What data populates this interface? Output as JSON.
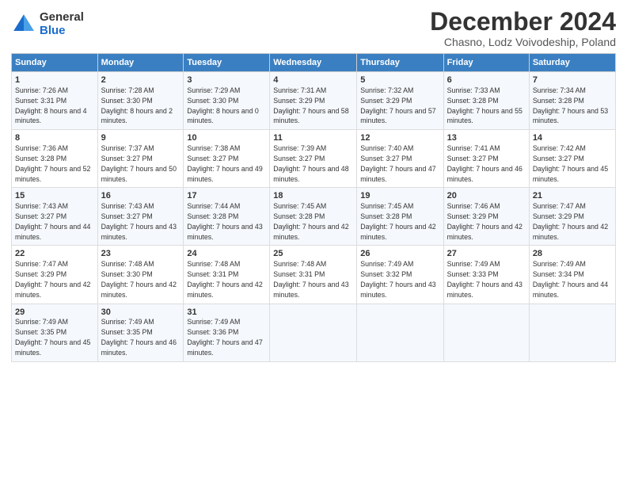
{
  "logo": {
    "general": "General",
    "blue": "Blue"
  },
  "title": "December 2024",
  "subtitle": "Chasno, Lodz Voivodeship, Poland",
  "headers": [
    "Sunday",
    "Monday",
    "Tuesday",
    "Wednesday",
    "Thursday",
    "Friday",
    "Saturday"
  ],
  "weeks": [
    [
      {
        "day": "1",
        "sunrise": "Sunrise: 7:26 AM",
        "sunset": "Sunset: 3:31 PM",
        "daylight": "Daylight: 8 hours and 4 minutes."
      },
      {
        "day": "2",
        "sunrise": "Sunrise: 7:28 AM",
        "sunset": "Sunset: 3:30 PM",
        "daylight": "Daylight: 8 hours and 2 minutes."
      },
      {
        "day": "3",
        "sunrise": "Sunrise: 7:29 AM",
        "sunset": "Sunset: 3:30 PM",
        "daylight": "Daylight: 8 hours and 0 minutes."
      },
      {
        "day": "4",
        "sunrise": "Sunrise: 7:31 AM",
        "sunset": "Sunset: 3:29 PM",
        "daylight": "Daylight: 7 hours and 58 minutes."
      },
      {
        "day": "5",
        "sunrise": "Sunrise: 7:32 AM",
        "sunset": "Sunset: 3:29 PM",
        "daylight": "Daylight: 7 hours and 57 minutes."
      },
      {
        "day": "6",
        "sunrise": "Sunrise: 7:33 AM",
        "sunset": "Sunset: 3:28 PM",
        "daylight": "Daylight: 7 hours and 55 minutes."
      },
      {
        "day": "7",
        "sunrise": "Sunrise: 7:34 AM",
        "sunset": "Sunset: 3:28 PM",
        "daylight": "Daylight: 7 hours and 53 minutes."
      }
    ],
    [
      {
        "day": "8",
        "sunrise": "Sunrise: 7:36 AM",
        "sunset": "Sunset: 3:28 PM",
        "daylight": "Daylight: 7 hours and 52 minutes."
      },
      {
        "day": "9",
        "sunrise": "Sunrise: 7:37 AM",
        "sunset": "Sunset: 3:27 PM",
        "daylight": "Daylight: 7 hours and 50 minutes."
      },
      {
        "day": "10",
        "sunrise": "Sunrise: 7:38 AM",
        "sunset": "Sunset: 3:27 PM",
        "daylight": "Daylight: 7 hours and 49 minutes."
      },
      {
        "day": "11",
        "sunrise": "Sunrise: 7:39 AM",
        "sunset": "Sunset: 3:27 PM",
        "daylight": "Daylight: 7 hours and 48 minutes."
      },
      {
        "day": "12",
        "sunrise": "Sunrise: 7:40 AM",
        "sunset": "Sunset: 3:27 PM",
        "daylight": "Daylight: 7 hours and 47 minutes."
      },
      {
        "day": "13",
        "sunrise": "Sunrise: 7:41 AM",
        "sunset": "Sunset: 3:27 PM",
        "daylight": "Daylight: 7 hours and 46 minutes."
      },
      {
        "day": "14",
        "sunrise": "Sunrise: 7:42 AM",
        "sunset": "Sunset: 3:27 PM",
        "daylight": "Daylight: 7 hours and 45 minutes."
      }
    ],
    [
      {
        "day": "15",
        "sunrise": "Sunrise: 7:43 AM",
        "sunset": "Sunset: 3:27 PM",
        "daylight": "Daylight: 7 hours and 44 minutes."
      },
      {
        "day": "16",
        "sunrise": "Sunrise: 7:43 AM",
        "sunset": "Sunset: 3:27 PM",
        "daylight": "Daylight: 7 hours and 43 minutes."
      },
      {
        "day": "17",
        "sunrise": "Sunrise: 7:44 AM",
        "sunset": "Sunset: 3:28 PM",
        "daylight": "Daylight: 7 hours and 43 minutes."
      },
      {
        "day": "18",
        "sunrise": "Sunrise: 7:45 AM",
        "sunset": "Sunset: 3:28 PM",
        "daylight": "Daylight: 7 hours and 42 minutes."
      },
      {
        "day": "19",
        "sunrise": "Sunrise: 7:45 AM",
        "sunset": "Sunset: 3:28 PM",
        "daylight": "Daylight: 7 hours and 42 minutes."
      },
      {
        "day": "20",
        "sunrise": "Sunrise: 7:46 AM",
        "sunset": "Sunset: 3:29 PM",
        "daylight": "Daylight: 7 hours and 42 minutes."
      },
      {
        "day": "21",
        "sunrise": "Sunrise: 7:47 AM",
        "sunset": "Sunset: 3:29 PM",
        "daylight": "Daylight: 7 hours and 42 minutes."
      }
    ],
    [
      {
        "day": "22",
        "sunrise": "Sunrise: 7:47 AM",
        "sunset": "Sunset: 3:29 PM",
        "daylight": "Daylight: 7 hours and 42 minutes."
      },
      {
        "day": "23",
        "sunrise": "Sunrise: 7:48 AM",
        "sunset": "Sunset: 3:30 PM",
        "daylight": "Daylight: 7 hours and 42 minutes."
      },
      {
        "day": "24",
        "sunrise": "Sunrise: 7:48 AM",
        "sunset": "Sunset: 3:31 PM",
        "daylight": "Daylight: 7 hours and 42 minutes."
      },
      {
        "day": "25",
        "sunrise": "Sunrise: 7:48 AM",
        "sunset": "Sunset: 3:31 PM",
        "daylight": "Daylight: 7 hours and 43 minutes."
      },
      {
        "day": "26",
        "sunrise": "Sunrise: 7:49 AM",
        "sunset": "Sunset: 3:32 PM",
        "daylight": "Daylight: 7 hours and 43 minutes."
      },
      {
        "day": "27",
        "sunrise": "Sunrise: 7:49 AM",
        "sunset": "Sunset: 3:33 PM",
        "daylight": "Daylight: 7 hours and 43 minutes."
      },
      {
        "day": "28",
        "sunrise": "Sunrise: 7:49 AM",
        "sunset": "Sunset: 3:34 PM",
        "daylight": "Daylight: 7 hours and 44 minutes."
      }
    ],
    [
      {
        "day": "29",
        "sunrise": "Sunrise: 7:49 AM",
        "sunset": "Sunset: 3:35 PM",
        "daylight": "Daylight: 7 hours and 45 minutes."
      },
      {
        "day": "30",
        "sunrise": "Sunrise: 7:49 AM",
        "sunset": "Sunset: 3:35 PM",
        "daylight": "Daylight: 7 hours and 46 minutes."
      },
      {
        "day": "31",
        "sunrise": "Sunrise: 7:49 AM",
        "sunset": "Sunset: 3:36 PM",
        "daylight": "Daylight: 7 hours and 47 minutes."
      },
      null,
      null,
      null,
      null
    ]
  ]
}
